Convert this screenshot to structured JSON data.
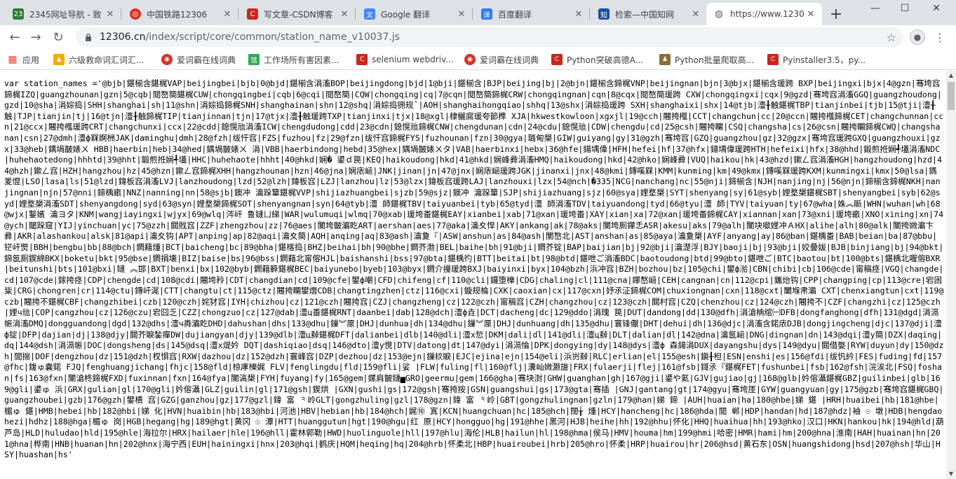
{
  "tabs": [
    {
      "title": "2345网址导航 - 致",
      "icon": "2345-icon",
      "color": "#2f7d32",
      "glyph": "23",
      "active": false
    },
    {
      "title": "中国铁路12306",
      "icon": "railway-icon",
      "color": "#d93025",
      "glyph": "◎",
      "active": false
    },
    {
      "title": "写文章-CSDN博客",
      "icon": "csdn-icon",
      "color": "#c9271c",
      "glyph": "C",
      "active": false
    },
    {
      "title": "Google 翻译",
      "icon": "google-translate-icon",
      "color": "#4285f4",
      "glyph": "文",
      "active": false
    },
    {
      "title": "百度翻译",
      "icon": "baidu-translate-icon",
      "color": "#2f7cf6",
      "glyph": "译",
      "active": false
    },
    {
      "title": "检索—中国知网",
      "icon": "cnki-icon",
      "color": "#1a4f9c",
      "glyph": "知",
      "active": false
    },
    {
      "title": "https://www.1230",
      "icon": "globe-icon",
      "color": "#5f6368",
      "glyph": "◍",
      "active": true
    }
  ],
  "address": {
    "host": "12306.cn",
    "path": "/index/script/core/common/station_name_v10037.js"
  },
  "bookmarks": [
    {
      "label": "应用",
      "icon": "apps-icon",
      "color": "#ea4335",
      "glyph": "▦"
    },
    {
      "label": "六级救命词汇词汇...",
      "icon": "book-icon",
      "color": "#f9ab00",
      "glyph": "▲"
    },
    {
      "label": "爱词霸在线词典",
      "icon": "iciba-icon",
      "color": "#d93025",
      "glyph": "◉"
    },
    {
      "label": "工作场所有害因素...",
      "icon": "doc-icon",
      "color": "#34a853",
      "glyph": "馆"
    },
    {
      "label": "selenium webdriv...",
      "icon": "csdn-icon",
      "color": "#c9271c",
      "glyph": "C"
    },
    {
      "label": "爱词霸在线词典",
      "icon": "iciba-icon",
      "color": "#d93025",
      "glyph": "◉"
    },
    {
      "label": "Python突破高德A...",
      "icon": "csdn-icon",
      "color": "#c9271c",
      "glyph": "C"
    },
    {
      "label": "Python批量爬取高...",
      "icon": "zhihu-icon",
      "color": "#8a6d3b",
      "glyph": "♟"
    },
    {
      "label": "Pyinstaller3.5，py...",
      "icon": "csdn-icon",
      "color": "#c9271c",
      "glyph": "C"
    }
  ],
  "code_text": "var station_names ='@bjb|鍖椾含鍖梶VAP|beijingbei|bjb|0@bjd|鍖椾含涓滀BOP|beijingdong|bjd|1@bji|鍖椾含|BJP|beijing|bj|2@bjn|鍖椾含鍗梶VNP|beijingnan|bjn|3@bjx|鍖椾含瑗跨 BXP|beijingxi|bjx|4@gzn|骞垮窞鍗梶IZQ|guangzhounan|gzn|5@cqb|閲嶅簡鍖梶CUW|chongqingbei|cqb|6@cqi|閲嶅簡|CQW|chongqing|cq|7@cqn|閲嶅簡鍗梶CRW|chongqingnan|cqn|8@cqx|閲嶅簡瑗跨 CXW|chongqingxi|cqx|9@gzd|骞垮窞涓滀GGQ|guangzhoudong|gzd|10@sha|涓婃捣|SHH|shanghai|sh|11@shn|涓婃捣鍗梶SNH|shanghainan|shn|12@shq|涓婃捣铏规ˉ|AOH|shanghaihongqiao|shhq|13@shx|涓婃捣瑗跨 SXH|shanghaixi|shx|14@tjb|澶╂触鍖梶TBP|tianjinbei|tjb|15@tji|澶╂触|TJP|tianjin|tj|16@tjn|澶╂触鍗梶TIP|tianjinnan|tjn|17@tjx|澶╂触瑗跨TXP|tianjinxi|tjx|18@xgl|棣欐腐瑗夸節榫 XJA|hkwestkowloon|xgxjl|19@cch|闀挎槬|CCT|changchun|cc|20@ccn|闀挎槬鍗梶CET|changchunnan|ccn|21@ccx|闀挎槬瑗跨CRT|changchunxi|ccx|22@cdd|鎴愰兘涓滀ICW|chengdudong|cdd|23@cdn|鎴愰兘鍗梶CNW|chengdunan|cdn|24@cdu|鎴愰兘|CDW|chengdu|cd|25@csh|闀挎矙|CSQ|changsha|cs|26@csn|闀挎矙鍗梶CWQ|changshanan|csn|27@dmh|澶ф槑婀栦JAK|daminghu|dmh|28@fzh|绂忓窞|FZS|fuzhou|fz|29@fzn|绂忓窞鍗梶FYS|fuzhounan|fzn|30@gya|璐甸槼|GIW|guiyang|gy|31@gzh|骞垮窞|GZQ|guangzhou|gz|32@gzx|骞垮窞瑗跨GXQ|guangzhouxi|gzx|33@heb|鍝堝皵婊ㄨ HBB|haerbin|heb|34@hed|鍝堝皵婊ㄨ 涓|VBB|haerbindong|hebd|35@hex|鍝堝皵婊ㄨタ|VAB|haerbinxi|hebx|36@hfe|鍚堣偉|HFH|hefei|hf|37@hfx|鍚堣偉瑗跨HTH|hefeixi|hfx|38@hhd|鍛煎拰娴╃壒涓滀NDC|huhehaotedong|hhhtd|39@hht|鍛煎拰娴╃壒|HHC|huhehaote|hhht|40@hkd|娴� 鍙ｄ笢|KEQ|haikoudong|hkd|41@hkd|娴峰彛涓滀HMQ|haikoudong|hkd|42@hko|娴峰彛|VUQ|haikou|hk|43@hzd|鏉ㄥ窞涓滀HGH|hangzhoudong|hzd|44@hzh|鏉ㄥ窞|HZH|hangzhou|hz|45@hzn|鏉ㄥ窞鍗梶XHH|hangzhounan|hzn|46@jna|娴庡崡|JNK|jinan|jn|47@jnx|娴庡崡瑗跨JGK|jinanxi|jnx|48@kmi|鏄嗘槑|KMM|kunming|km|49@kmx|鏄嗘槑瑗跨KXM|kunmingxi|kmx|50@lsa|鎷夎惃|LSO|lasa|ls|51@lzd|鍏板窞涓滀LVJ|lanzhoudong|lzd|52@lzh|鍏板窞|LZJ|lanzhou|lz|53@lzx|鍏板窞瑗跨LAJ|lanzhouxi|lzx|54@nch|�335|NCG|nanchang|nc|55@nji|鍗椾含|NJH|nanjing|nj|56@njn|鍗椾含鍗梶NKH|nanjingnan|njn|57@nni|鍗楀畞|NNZ|nanning|nn|58@sjb|鐭冲 瀹跺簞鍖梶VVP|shijiazhuangbei|sjzb|59@sjz|鐭冲 瀹跺簞|SJP|shijiazhuang|sjz|60@sya|娌堥槼|SYT|shenyang|sy|61@syb|娌堥槼鍖梶SBT|shenyangbei|syb|62@syd|娌堥槼涓滀SDT|shenyangdong|syd|63@syn|娌堥槼鍗梶SOT|shenyangnan|syn|64@tyb|澶 師鍖梶TBV|taiyuanbei|tyb|65@tyd|澶 師涓滀TDV|taiyuandong|tyd|66@tyu|澶 師|TYV|taiyuan|ty|67@wha|姝︽眽|WHN|wuhan|wh|68@wjx|鐜嬪 瀹ヨタ|KNM|wangjiayingxi|wjyx|69@wlq|涔屽 鲁鏈ㄩ綈|WAR|wulumuqi|wlmq|70@xab|瑗垮畨鍖梶EAY|xianbei|xab|71@xan|瑗垮畨|XAY|xian|xa|72@xan|瑗垮畨鍗梶CAY|xiannan|xan|73@xni|瑗垮畞|XNO|xining|xn|74@ych|閾跺窛|YIJ|yinchuan|yc|75@zzh|閮戝窞|ZZF|zhengzhou|zz|76@aes|闃垮皵灞盵ART|aershan|aes|77@aka|瀹夊悍|AKY|ankang|ak|78@aks|闃垮厠鑻忎ASR|akesu|aks|79@alh|闃块噷娌冲ＡHX|alihe|alh|80@alk|闃挎媺灞卞彛|AKR|alashankou|alsk|81@api|瀹夊钩|APT|anping|ap|82@aqi|瀹夊簡|AQH|anqing|aq|83@ash|瀹夐『|ASW|anshun|as|84@ash|闉嶅北|AST|anshan|as|85@aya|瀹夐槼|AYF|anyang|ay|86@ban|鍖楀畨|BAB|beian|ba|87@bbu|铓屽煚|BBH|bengbu|bb|88@bch|鐧藉煄|BCT|baicheng|bc|89@bha|鍖楁捣|BHZ|beihai|bh|90@bhe|鐧芥渤|BEL|baihe|bh|91@bji|鐧芥锭|BAP|baijian|bj|92@bji|瀹濋浮|BJY|baoji|bj|93@bji|姣曡妭|BJB|binjiang|bj|94@bkt|鍗氬厠鍥綿BKX|boketu|bkt|95@bse|鐧捐壊|BIZ|baise|bs|96@bss|鐧藉北甯傛HJL|baishanshi|bss|97@bta|鍖楀彴|BTT|beitai|bt|98@btd|鍖呭ご涓滀BDC|baotoudong|btd|99@bto|鍖呭ご|BTC|baotou|bt|100@bts|鍖楀北喔傛BXR|beitunshi|bts|101@bxi|鏈 ︽邯|BXT|benxi|bx|102@byb|鐧藉簳鍖梶BEC|baiyunebo|byeb|103@byx|鐧介摱瑗跨BXJ|baiyinxi|byx|104@bzh|浜冲窞|BZH|bozhou|bz|105@chi|鐢ф湁|CBN|chibi|cb|106@cde|甯稿痉|VGQ|changde|cd|107@cde|鎵挎痉|CDP|chengde|cd|108@cdi|闀垮矝|CDT|changdian|cd|109@cfe|鐢ф嘲|CFD|chifeng|cf|110@cli|鑼堕櫟|CDG|chaling|cl|111@cna|鑻嶅崡|CEH|cangnan|cn|112@cpi|鑴炲钩|CPP|changping|cp|113@cre|宕囦粊|CRG|chongren|cr|114@ctu|鏄屽浘|CTT|changtu|ct|115@ctz|闀挎矙鐢熸CDB|changtingzhen|ctz|116@cxi|鏇规棆|CXK|caoxian|cx|117@cxn|妤氶泟鍗梶COM|chuxiongnan|cxn|118@cxt|闄堢帇灞 CXT|chenxiangtun|cxt|119@czb|闀挎不鍖梶CBF|changzhibei|czb|120@czh|姹犲窞|IYH|chizhou|cz|121@czh|闀挎窞|CZJ|changzheng|cz|122@czh|甯稿窞|CZH|changzhou|cz|123@czh|閮村窞|CZQ|chenzhou|cz|124@czh|闀挎不|CZF|changzhi|cz|125@czh|娌ч兘|COP|cangzhou|cz|126@czu|宕囧乏|CZZ|chongzuo|cz|127@dab|澶ц畨鍖梶RNT|daanbei|dab|128@dch|澶ф垚|DCT|dacheng|dc|129@ddo|涓瑰 笢|DUT|dandong|dd|130@dfh|涓滄柟绾㈠DFB|dongfanghong|dfh|131@dgd|涓滆帪涓滀DMQ|dongguandong|dgd|132@dhs|澶ч粦灞盵DHD|dahushan|dhs|133@dhu|鏁︾厡|DHJ|dunhua|dh|134@dhu|鏁︾厡|DHJ|dunhuang|dh|135@dhu|寰锋儬|DHT|dehui|dh|136@djc|涓滀含鍩庡DJB|dongjingcheng|djc|137@dji|澶ф锭|DFP|dajian|dj|138@djy|閮芥睙鍫癉DW|dujiangyan|djy|139@dlb|澶ц繛鍖梶DFT|dalianbei|dlb|140@dli|澶х悊|DKM|dali|dl|141@dli|澶ц繛|DLT|dalian|dl|142@dna|瀹氬崡|DNG|dingnan|dn|143@dqi|澶у簡|DZX|daqing|dq|144@dsh|涓滆帪|DOC|dongsheng|ds|145@dsq|澶х煶妗 DQT|dashiqiao|dsq|146@dto|澶у悓|DTV|datong|dt|147@dyi|涓滆惀|DPK|dongying|dy|148@dys|澶ф 森鍚涓DUX|dayangshu|dys|149@dyu|閮借嫳|RYW|duyun|dy|150@dzh|閭揣|DOF|dengzhou|dz|151@dzh|杈惧窞|RXW|dazhou|dz|152@dzh|寰峰窞|DZP|dezhou|dz|153@ejn|鏁栨睙|EJC|ejina|ejn|154@eli|浜岃繛|RLC|erlian|el|155@esh|鎭╂柦|ESN|enshi|es|156@fdi|绂忛紟|FES|fuding|fd|157@fhc|鍑ゅ嚢鍩 FJQ|fenghuangjichang|fhjc|158@fld|椋庨櫟娓 FLV|fenglingdu|fld|159@fli|娑 |FLW|fuling|fl|160@flj|瀵屾媺灏旇|FRX|fulaerji|flej|161@fsb|鎶氶『鍖梶FET|fushunbei|fsb|162@fsh|浣涘北|FSQ|foshan|fs|163@fxn|闃滄柊鍗梶FXD|fuxinnan|fxn|164@fya|闃滈槼|FYH|fuyang|fy|165@gem|鏍肩皵鏈▅GRO|geermu|gem|166@gha|骞块湗|GHW|guanghan|gh|167@gji|鍙や氦|GJV|gujiao|gj|168@glb|妗傛灄鍖梶GBZ|guilinbei|glb|169@gli|鍙ゅ 浜|GRX|gulian|gl|170@gli|妗傛灄|GLZ|guilin|gl|171@gsh|鍥烘 |GXN|gushi|gs|172@gsh|骞挎按|GSN|guangshui|gs|173@gta|骞插 |GNJ|gantang|gt|174@gyu|骞垮厓|GYW|guangyuan|gy|175@gzb|骞垮窞鍖梶GBQ|guangzhoubei|gzb|176@gzh|鐢樻 窞|GZG|ganzhou|gz|177@gzl|鍏 富 ⺀岭GLT|gongzhuling|gzl|178@gzn|鍏 富 ⺀岭|GBT|gongzhulingnan|gzln|179@han|娣 鍗 |AUH|huaian|ha|180@hbe|娣 鍖 |HRH|huaibei|hb|181@hbe|楣ゅ 鍖|HMB|hebei|hb|182@hbi|娣 化|HVN|huaibin|hb|183@hbi|河池|HBV|hebian|hb|184@hch|娓⑩ 寘|KCN|huangchuan|hc|185@hch|闊╁ 煄|HCY|hancheng|hc|186@hda|閭 郸|HDP|handan|hd|187@hdz|袖 ☉ 墩|HDB|hengdaohezi|hdhz|188@hga|楣ゅ 岗|HGB|hegang|hg|189@hgt|黄冈 ☉ 潭|HTT|huanggutun|hgt|190@hgu|红 原|HCY|hongguo|hg|191@hhe|黑河|HJB|heihe|hh|192@hhu|怀化|HHQ|huaihua|hh|193@hko|汉口|HKN|hankou|hk|194@hld|葫芦岛|HLD|huludao|hld|195@hle|海拉尔|HRX|hailaer|hle|196@hll|霍林郭勒|HWD|huolinguole|hll|197@hlu|海伦|HLB|hailun|hl|198@hma|侯马|HMV|houma|hm|199@hmi|哈密|HMR|hami|hm|200@hna|淮南|HAH|huainan|hn|201@hna|桦南|HNB|huanan|hn|202@hnx|海宁西|EUH|hainingxi|hnx|203@hqi|鹤庆|HQM|heqing|hq|204@hrb|怀柔北|HBP|huairoubei|hrb|205@hro|怀柔|HRP|huairou|hr|206@hsd|黄石东|OSN|huangshidong|hsd|207@hsh|华山|HSY|huashan|hs'"
}
